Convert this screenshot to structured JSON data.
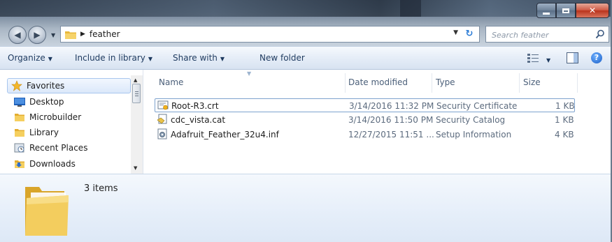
{
  "window": {
    "controls": [
      "minimize",
      "maximize",
      "close"
    ]
  },
  "address": {
    "path": "feather",
    "search_placeholder": "Search feather"
  },
  "toolbar": {
    "organize": "Organize",
    "include_in_library": "Include in library",
    "share_with": "Share with",
    "new_folder": "New folder"
  },
  "nav": {
    "items": [
      {
        "label": "Favorites",
        "icon": "star-icon"
      },
      {
        "label": "Desktop",
        "icon": "desktop-icon"
      },
      {
        "label": "Microbuilder",
        "icon": "folder-icon"
      },
      {
        "label": "Library",
        "icon": "folder-icon"
      },
      {
        "label": "Recent Places",
        "icon": "recent-places-icon"
      },
      {
        "label": "Downloads",
        "icon": "downloads-icon"
      }
    ]
  },
  "files": {
    "columns": [
      "Name",
      "Date modified",
      "Type",
      "Size"
    ],
    "rows": [
      {
        "name": "Root-R3.crt",
        "date": "3/14/2016 11:32 PM",
        "type": "Security Certificate",
        "size": "1 KB",
        "icon": "certificate-icon"
      },
      {
        "name": "cdc_vista.cat",
        "date": "3/14/2016 11:50 PM",
        "type": "Security Catalog",
        "size": "1 KB",
        "icon": "catalog-icon"
      },
      {
        "name": "Adafruit_Feather_32u4.inf",
        "date": "12/27/2015 11:51 ...",
        "type": "Setup Information",
        "size": "4 KB",
        "icon": "setup-info-icon"
      }
    ]
  },
  "details": {
    "items_count": "3 items"
  },
  "colors": {
    "folder": "#f0c54a",
    "selection_border": "#7da2ce",
    "command_bar": "#dfe8f4"
  }
}
